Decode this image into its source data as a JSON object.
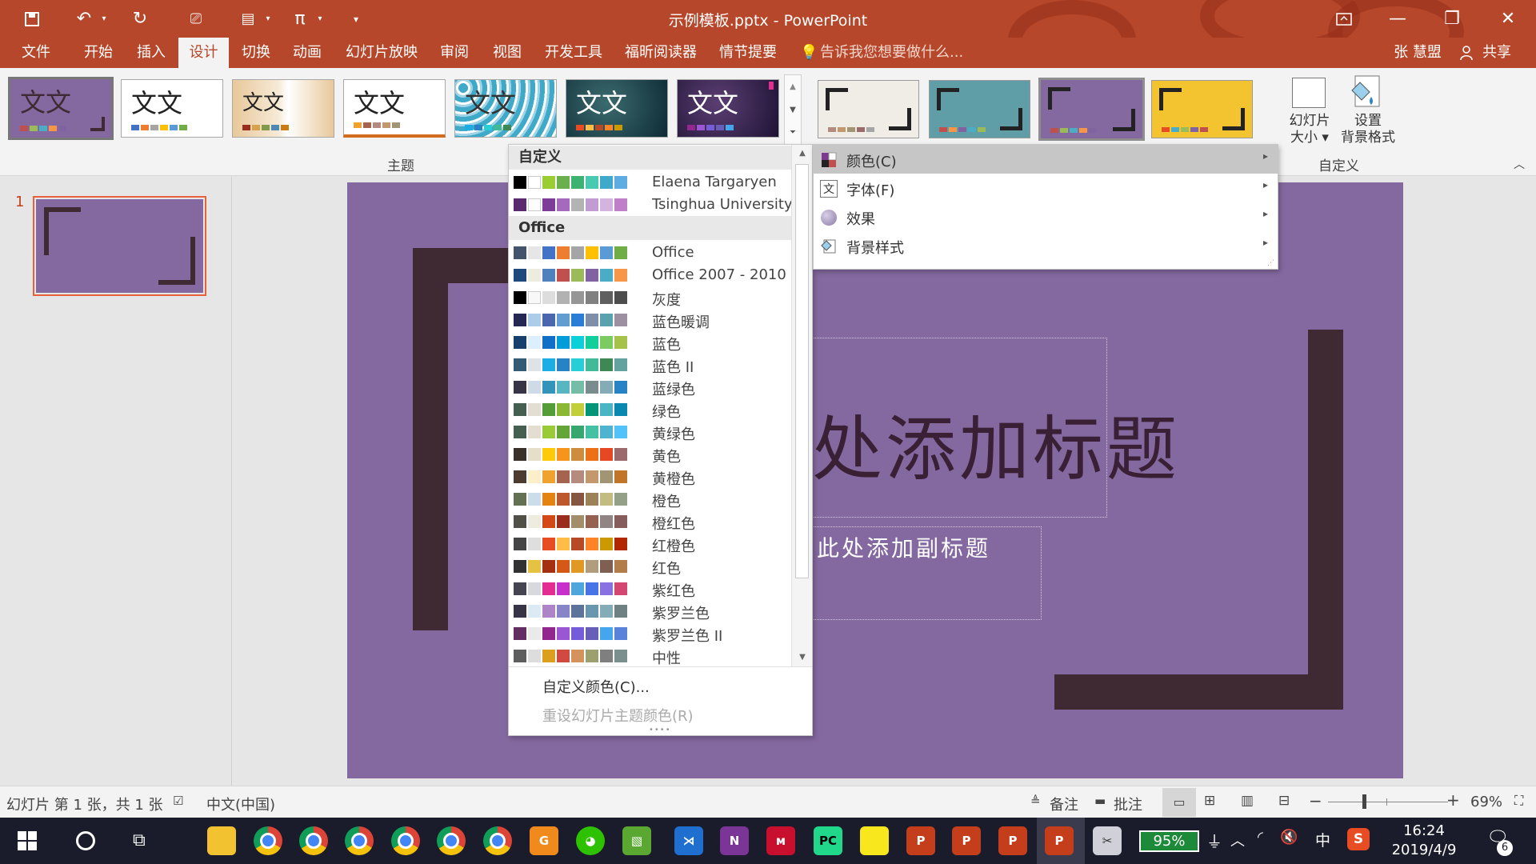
{
  "window": {
    "title": "示例模板.pptx - PowerPoint",
    "user": "张 慧盟",
    "share_label": "共享"
  },
  "menu": {
    "tabs": [
      "文件",
      "开始",
      "插入",
      "设计",
      "切换",
      "动画",
      "幻灯片放映",
      "审阅",
      "视图",
      "开发工具",
      "福昕阅读器",
      "情节提要"
    ],
    "active": "设计",
    "tell_me": "告诉我您想要做什么..."
  },
  "ribbon": {
    "themes_group_label": "主题",
    "customize_group_label": "自定义",
    "theme_thumbnail_text": "文文",
    "slide_size_label_1": "幻灯片",
    "slide_size_label_2": "大小",
    "format_bg_label_1": "设置",
    "format_bg_label_2": "背景格式"
  },
  "thumbnail_pane": {
    "slide_number": "1"
  },
  "slide": {
    "title_fragment": "处添加标题",
    "subtitle_fragment": "此处添加副标题"
  },
  "colors_dropdown": {
    "custom_header": "自定义",
    "custom_items": [
      {
        "name": "Elaena Targaryen",
        "swatches": [
          "#000000",
          "#ffffff",
          "#9acd32",
          "#6ab04c",
          "#3cb371",
          "#48c9b0",
          "#3fa9c9",
          "#5dade2"
        ]
      },
      {
        "name": "Tsinghua University",
        "swatches": [
          "#5a2a6e",
          "#ffffff",
          "#7d3c98",
          "#a569bd",
          "#b3b3b3",
          "#c39bd3",
          "#d2b4de",
          "#c07fc9"
        ]
      }
    ],
    "office_header": "Office",
    "office_items": [
      {
        "name": "Office",
        "swatches": [
          "#44546a",
          "#e7e6e6",
          "#4472c4",
          "#ed7d31",
          "#a5a5a5",
          "#ffc000",
          "#5b9bd5",
          "#70ad47"
        ]
      },
      {
        "name": "Office 2007 - 2010",
        "swatches": [
          "#1f497d",
          "#eeece1",
          "#4f81bd",
          "#c0504d",
          "#9bbb59",
          "#8064a2",
          "#4bacc6",
          "#f79646"
        ]
      },
      {
        "name": "灰度",
        "swatches": [
          "#000000",
          "#f8f8f8",
          "#dddddd",
          "#b2b2b2",
          "#969696",
          "#808080",
          "#5f5f5f",
          "#4d4d4d"
        ]
      },
      {
        "name": "蓝色暖调",
        "swatches": [
          "#242852",
          "#acccea",
          "#4a66ac",
          "#629dd1",
          "#297fd5",
          "#7f8fa9",
          "#5aa2ae",
          "#9d90a0"
        ]
      },
      {
        "name": "蓝色",
        "swatches": [
          "#17406d",
          "#dbefff",
          "#0f6fc6",
          "#009dd9",
          "#0bd0d9",
          "#10cf9b",
          "#7cca62",
          "#a5c249"
        ]
      },
      {
        "name": "蓝色 II",
        "swatches": [
          "#335b74",
          "#dfe3e5",
          "#1cade4",
          "#2683c6",
          "#27ced7",
          "#42ba97",
          "#3e8853",
          "#62a39f"
        ]
      },
      {
        "name": "蓝绿色",
        "swatches": [
          "#373545",
          "#cedbe6",
          "#3494ba",
          "#58b6c0",
          "#75bda7",
          "#7a8c8e",
          "#84acb6",
          "#2683c6"
        ]
      },
      {
        "name": "绿色",
        "swatches": [
          "#455f51",
          "#e3ded1",
          "#549e39",
          "#8ab833",
          "#c0cf3a",
          "#029676",
          "#4ab5c4",
          "#0989b1"
        ]
      },
      {
        "name": "黄绿色",
        "swatches": [
          "#455f51",
          "#e3ded1",
          "#99cb38",
          "#63a537",
          "#37a76f",
          "#44c1a3",
          "#4eb3cf",
          "#51c3f9"
        ]
      },
      {
        "name": "黄色",
        "swatches": [
          "#39302a",
          "#e5dec9",
          "#ffca08",
          "#f8931d",
          "#ce8d3e",
          "#ec7016",
          "#e64823",
          "#9c6a6a"
        ]
      },
      {
        "name": "黄橙色",
        "swatches": [
          "#4e3b30",
          "#fbeec9",
          "#f0a22e",
          "#a5644e",
          "#b58b80",
          "#c3986d",
          "#a19574",
          "#c17529"
        ]
      },
      {
        "name": "橙色",
        "swatches": [
          "#637052",
          "#ccddea",
          "#e48312",
          "#bd582c",
          "#865640",
          "#9b8357",
          "#c2bc80",
          "#94a088"
        ]
      },
      {
        "name": "橙红色",
        "swatches": [
          "#505046",
          "#eeece1",
          "#d34817",
          "#9b2d1f",
          "#a28e6a",
          "#956251",
          "#918485",
          "#855d5d"
        ]
      },
      {
        "name": "红橙色",
        "swatches": [
          "#454545",
          "#dedede",
          "#e84c22",
          "#ffbd47",
          "#b64926",
          "#ff8427",
          "#cc9900",
          "#b22600"
        ]
      },
      {
        "name": "红色",
        "swatches": [
          "#323232",
          "#e5c243",
          "#a5300f",
          "#d55816",
          "#e19825",
          "#b19c7d",
          "#7f5f52",
          "#b27d49"
        ]
      },
      {
        "name": "紫红色",
        "swatches": [
          "#454551",
          "#d8d9dc",
          "#e32d91",
          "#c830cc",
          "#4ea6dc",
          "#4775e7",
          "#8971e1",
          "#d54773"
        ]
      },
      {
        "name": "紫罗兰色",
        "swatches": [
          "#373545",
          "#dceaf6",
          "#ad84c6",
          "#8784c7",
          "#5d739a",
          "#6997af",
          "#84acb6",
          "#6f8183"
        ]
      },
      {
        "name": "紫罗兰色 II",
        "swatches": [
          "#632e62",
          "#eaeaea",
          "#92278f",
          "#9b57d3",
          "#755dd9",
          "#665eb8",
          "#45a5ed",
          "#5982db"
        ]
      },
      {
        "name": "中性",
        "swatches": [
          "#5e5e5e",
          "#ddddde",
          "#dc9e1f",
          "#d04a41",
          "#d4925d",
          "#9c9f6e",
          "#7f7f7f",
          "#7b8f8e"
        ]
      }
    ],
    "customize_colors": "自定义颜色(C)...",
    "reset_colors": "重设幻灯片主题颜色(R)"
  },
  "variants_submenu": {
    "items": [
      "颜色(C)",
      "字体(F)",
      "效果",
      "背景样式"
    ]
  },
  "statusbar": {
    "slide_info": "幻灯片 第 1 张，共 1 张",
    "language": "中文(中国)",
    "notes": "备注",
    "comments": "批注",
    "zoom": "69%"
  },
  "taskbar": {
    "battery": "95%",
    "time": "16:24",
    "date": "2019/4/9",
    "ime": "中",
    "notification_count": "6"
  },
  "colors": {
    "accent": "#b7472a",
    "slide_bg": "#8469a0",
    "bracket": "#3f2932"
  }
}
